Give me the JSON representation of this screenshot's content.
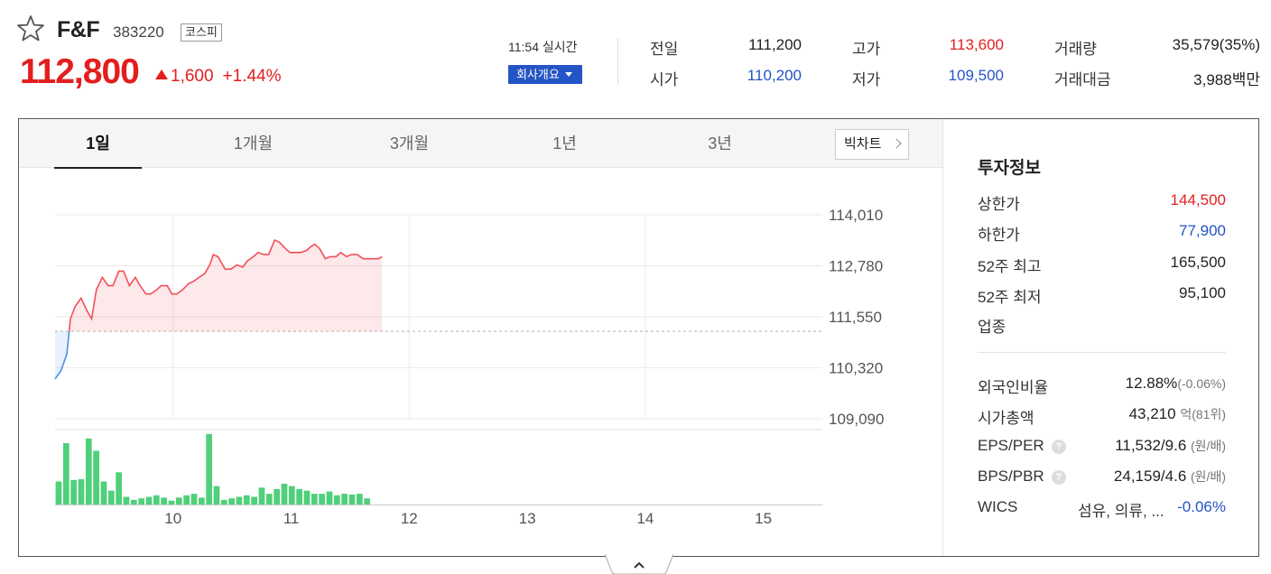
{
  "stock": {
    "name": "F&F",
    "code": "383220",
    "market": "코스피",
    "price": "112,800",
    "change": "1,600",
    "change_rate": "+1.44%",
    "realtime_time": "11:54 실시간",
    "overview_button": "회사개요"
  },
  "quote": [
    {
      "label": "전일",
      "value": "111,200",
      "color": ""
    },
    {
      "label": "고가",
      "value": "113,600",
      "color": "red"
    },
    {
      "label": "거래량",
      "value": "35,579(35%)",
      "color": ""
    },
    {
      "label": "시가",
      "value": "110,200",
      "color": "blue"
    },
    {
      "label": "저가",
      "value": "109,500",
      "color": "blue"
    },
    {
      "label": "거래대금",
      "value": "3,988백만",
      "color": ""
    }
  ],
  "tabs": [
    "1일",
    "1개월",
    "3개월",
    "1년",
    "3년"
  ],
  "active_tab": "1일",
  "big_chart_label": "빅차트",
  "chart_data": {
    "type": "line",
    "y_ticks": [
      "114,010",
      "112,780",
      "111,550",
      "110,320",
      "109,090"
    ],
    "y_range": [
      109090,
      114010
    ],
    "x_ticks": [
      "10",
      "11",
      "12",
      "13",
      "14",
      "15"
    ],
    "x_range_hours": [
      9,
      15.5
    ],
    "prev_close": 111200,
    "price_series": [
      [
        9.0,
        110050
      ],
      [
        9.05,
        110250
      ],
      [
        9.1,
        110650
      ],
      [
        9.13,
        111500
      ],
      [
        9.17,
        111800
      ],
      [
        9.22,
        112000
      ],
      [
        9.27,
        111700
      ],
      [
        9.31,
        111500
      ],
      [
        9.35,
        112200
      ],
      [
        9.4,
        112500
      ],
      [
        9.45,
        112300
      ],
      [
        9.49,
        112300
      ],
      [
        9.54,
        112650
      ],
      [
        9.58,
        112650
      ],
      [
        9.63,
        112300
      ],
      [
        9.68,
        112500
      ],
      [
        9.72,
        112300
      ],
      [
        9.77,
        112100
      ],
      [
        9.81,
        112100
      ],
      [
        9.86,
        112200
      ],
      [
        9.9,
        112300
      ],
      [
        9.95,
        112300
      ],
      [
        9.99,
        112100
      ],
      [
        10.03,
        112100
      ],
      [
        10.08,
        112200
      ],
      [
        10.13,
        112350
      ],
      [
        10.17,
        112400
      ],
      [
        10.22,
        112500
      ],
      [
        10.27,
        112600
      ],
      [
        10.31,
        112800
      ],
      [
        10.34,
        113050
      ],
      [
        10.38,
        113000
      ],
      [
        10.44,
        112700
      ],
      [
        10.49,
        112700
      ],
      [
        10.54,
        112800
      ],
      [
        10.59,
        112750
      ],
      [
        10.63,
        112900
      ],
      [
        10.68,
        113000
      ],
      [
        10.72,
        113100
      ],
      [
        10.77,
        113050
      ],
      [
        10.81,
        113050
      ],
      [
        10.86,
        113400
      ],
      [
        10.9,
        113350
      ],
      [
        10.95,
        113200
      ],
      [
        10.99,
        113100
      ],
      [
        11.04,
        113100
      ],
      [
        11.08,
        113100
      ],
      [
        11.13,
        113150
      ],
      [
        11.17,
        113250
      ],
      [
        11.2,
        113300
      ],
      [
        11.24,
        113200
      ],
      [
        11.29,
        112950
      ],
      [
        11.33,
        113000
      ],
      [
        11.38,
        113000
      ],
      [
        11.42,
        113100
      ],
      [
        11.47,
        113000
      ],
      [
        11.51,
        113050
      ],
      [
        11.56,
        113050
      ],
      [
        11.61,
        112950
      ],
      [
        11.65,
        112950
      ],
      [
        11.7,
        112950
      ],
      [
        11.74,
        112950
      ],
      [
        11.77,
        113000
      ]
    ],
    "volume": [
      30,
      80,
      32,
      33,
      86,
      70,
      30,
      18,
      42,
      10,
      6,
      8,
      10,
      12,
      9,
      5,
      9,
      12,
      14,
      9,
      92,
      24,
      6,
      8,
      10,
      12,
      10,
      22,
      14,
      20,
      27,
      24,
      20,
      18,
      14,
      14,
      17,
      12,
      14,
      13,
      14,
      8
    ],
    "volume_range": [
      0,
      100
    ]
  },
  "invest": {
    "title": "투자정보",
    "rows1": [
      {
        "label": "상한가",
        "value": "144,500",
        "color": "red"
      },
      {
        "label": "하한가",
        "value": "77,900",
        "color": "blue"
      },
      {
        "label": "52주 최고",
        "value": "165,500",
        "color": ""
      },
      {
        "label": "52주 최저",
        "value": "95,100",
        "color": ""
      },
      {
        "label": "업종",
        "value": "",
        "color": ""
      }
    ],
    "foreign_label": "외국인비율",
    "foreign_value": "12.88%",
    "foreign_sub": "(-0.06%)",
    "mcap_label": "시가총액",
    "mcap_value": "43,210",
    "mcap_sub": "억(81위)",
    "eps_label": "EPS/PER",
    "eps_value": "11,532/9.6",
    "eps_sub": "(원/배)",
    "bps_label": "BPS/PBR",
    "bps_value": "24,159/4.6",
    "bps_sub": "(원/배)",
    "help_glyph": "?",
    "wics_label": "WICS",
    "wics_value": "섬유, 의류, ...",
    "wics_change": "-0.06%"
  },
  "colors": {
    "up": "#e41e1e",
    "down": "#2454c6",
    "volume": "#4fd07a"
  }
}
